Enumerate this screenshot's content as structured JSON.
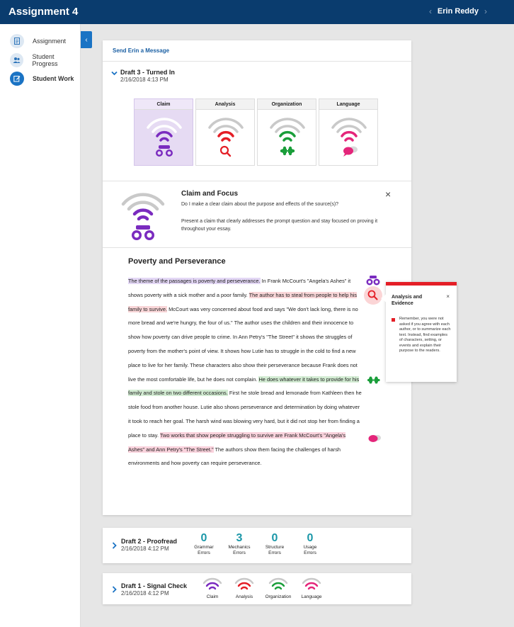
{
  "header": {
    "title": "Assignment 4",
    "student_name": "Erin Reddy",
    "prev_arrow": "‹",
    "next_arrow": "›"
  },
  "sidebar": {
    "collapse": "‹",
    "items": [
      {
        "label": "Assignment",
        "icon": "document-icon"
      },
      {
        "label": "Student Progress",
        "icon": "people-icon"
      },
      {
        "label": "Student Work",
        "icon": "edit-icon",
        "active": true
      }
    ]
  },
  "main": {
    "send_message": "Send Erin a Message",
    "current_draft": {
      "title": "Draft 3 - Turned In",
      "date": "2/16/2018 4:13 PM"
    },
    "tiles": [
      {
        "label": "Claim",
        "icon": "binoculars-icon",
        "color": "#7a2bbf"
      },
      {
        "label": "Analysis",
        "icon": "magnifier-icon",
        "color": "#e41e26"
      },
      {
        "label": "Organization",
        "icon": "puzzle-icon",
        "color": "#1a9e3a"
      },
      {
        "label": "Language",
        "icon": "speech-bubble-icon",
        "color": "#e4257a"
      }
    ],
    "focus": {
      "title": "Claim and Focus",
      "question": "Do I make a clear claim about the purpose and effects of the source(s)?",
      "description": "Present a claim that clearly addresses the prompt question and stay focused on proving it throughout your essay.",
      "close": "×"
    },
    "essay": {
      "title": "Poverty and Perseverance",
      "p1_claim": "The theme of the passages is poverty and perseverance.",
      "p2": " In Frank McCourt's \"Angela's Ashes\" it shows poverty with a sick mother and a poor family. ",
      "p3_analysis": "The author has to steal from people to help his family to survive.",
      "p4": " McCourt was very concerned about food and says \"We don't lack long, there is no more bread and we're hungry, the four of us.\" The author uses the children and their innocence to show how poverty can drive people to crime. In Ann Petry's \"The Street\" it shows the struggles of poverty from the mother's point of view. It shows how Lutie has to struggle in the cold to find a new place to live for her family. These characters also show their perseverance because Frank does not live the most comfortable life, but he does not complain. ",
      "p5_organization": "He does whatever it takes to provide for his family and stole on two different occasions.",
      "p6": " First he stole bread and lemonade from Kathleen then he stole food from another house. Lutie also shows perseverance and determination by doing whatever it took to reach her goal. The harsh wind was blowing very hard, but it did not stop her from finding a place to stay. ",
      "p7_language": "Two works that show people struggling to survive are Frank McCourt's \"Angela's Ashes\" and Ann Petry's \"The Street.\"",
      "p8": " The authors show them facing the challenges of harsh environments and how poverty can require perseverance."
    },
    "popup": {
      "title": "Analysis and Evidence",
      "close": "×",
      "text": "Remember, you were not asked if you agree with each author, or to summarize each text. Instead, find examples of characters, setting, or events and explain their purpose to the readers."
    }
  },
  "draft2": {
    "title": "Draft 2 - Proofread",
    "date": "2/16/2018 4:12 PM",
    "stats": [
      {
        "value": "0",
        "label1": "Grammar",
        "label2": "Errors"
      },
      {
        "value": "3",
        "label1": "Mechanics",
        "label2": "Errors"
      },
      {
        "value": "0",
        "label1": "Structure",
        "label2": "Errors"
      },
      {
        "value": "0",
        "label1": "Usage",
        "label2": "Errors"
      }
    ]
  },
  "draft1": {
    "title": "Draft 1 - Signal Check",
    "date": "2/16/2018 4:12 PM",
    "signals": [
      {
        "label": "Claim",
        "color": "#7a2bbf"
      },
      {
        "label": "Analysis",
        "color": "#e41e26"
      },
      {
        "label": "Organization",
        "color": "#1a9e3a"
      },
      {
        "label": "Language",
        "color": "#e4257a"
      }
    ]
  }
}
